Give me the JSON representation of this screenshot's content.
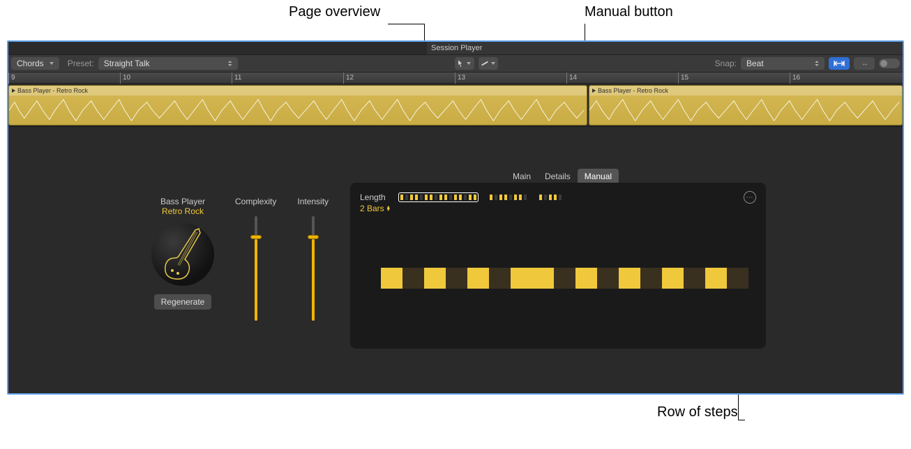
{
  "callouts": {
    "page_overview": "Page overview",
    "manual_button": "Manual button",
    "row_of_steps": "Row of steps"
  },
  "header": {
    "title": "Session Player"
  },
  "toolbar": {
    "chords_label": "Chords",
    "preset_label": "Preset:",
    "preset_value": "Straight Talk",
    "snap_label": "Snap:",
    "snap_value": "Beat"
  },
  "ruler": {
    "ticks": [
      "9",
      "10",
      "11",
      "12",
      "13",
      "14",
      "15",
      "16"
    ]
  },
  "regions": {
    "r1_name": "Bass Player - Retro Rock",
    "r2_name": "Bass Player - Retro Rock"
  },
  "tabs": {
    "main": "Main",
    "details": "Details",
    "manual": "Manual"
  },
  "player": {
    "title": "Bass Player",
    "style": "Retro Rock",
    "regenerate": "Regenerate"
  },
  "sliders": {
    "complexity_label": "Complexity",
    "complexity_value": 0.78,
    "intensity_label": "Intensity",
    "intensity_value": 0.78
  },
  "manual_panel": {
    "length_label": "Length",
    "length_value": "2 Bars",
    "overview_pages": [
      [
        1,
        0,
        1,
        1,
        0,
        1,
        1,
        0,
        1,
        1,
        0,
        1,
        1,
        0,
        1,
        1
      ],
      [
        1,
        0,
        1,
        1,
        0,
        1,
        1,
        0
      ],
      [
        1,
        0,
        1,
        1,
        0
      ]
    ],
    "selected_page": 0,
    "steps": [
      1,
      0,
      1,
      0,
      1,
      0,
      1,
      1,
      0,
      1,
      0,
      1,
      0,
      1,
      0,
      1,
      0
    ]
  }
}
